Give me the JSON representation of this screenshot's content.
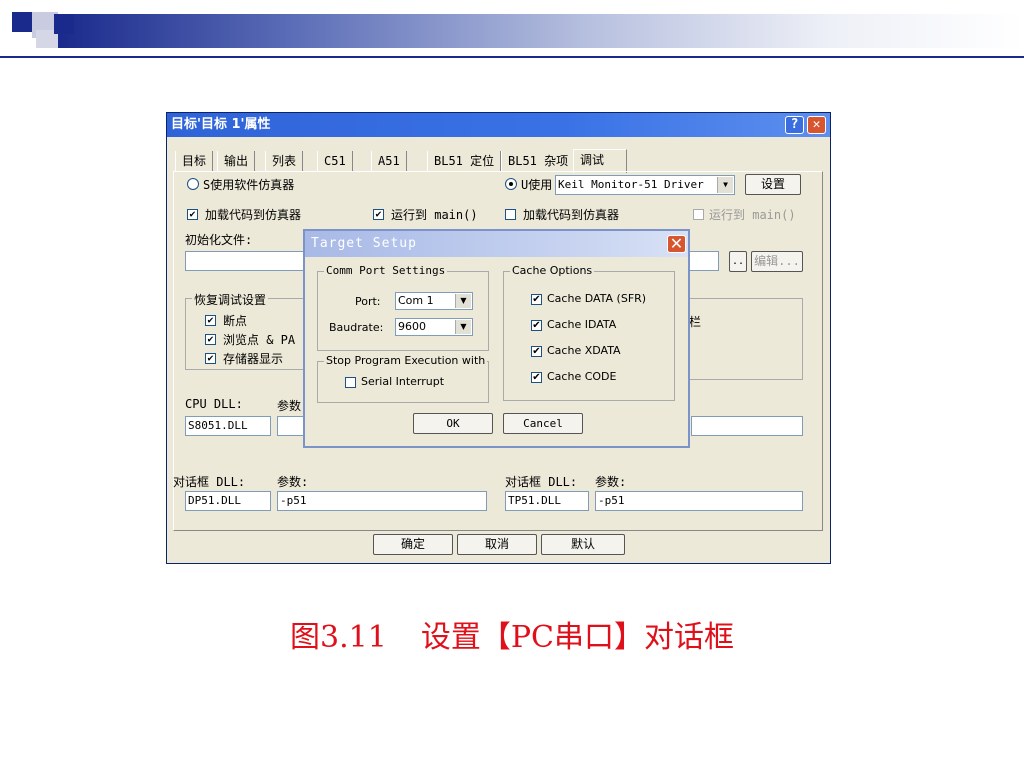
{
  "window": {
    "title": "目标'目标 1'属性",
    "help": "?",
    "close": "✕"
  },
  "tabs": [
    "目标",
    "输出",
    "列表",
    "C51",
    "A51",
    "BL51 定位",
    "BL51 杂项",
    "调试"
  ],
  "left": {
    "sim_radio": "S使用软件仿真器",
    "load_code": "加载代码到仿真器",
    "run_main": "运行到 main()",
    "init_file_label": "初始化文件:",
    "restore_group": "恢复调试设置",
    "breakpoints": "断点",
    "watchpoints": "浏览点 & PA",
    "memory_display": "存储器显示",
    "cpu_dll_label": "CPU DLL:",
    "params_label": "参数",
    "cpu_dll_value": "S8051.DLL",
    "dlg_dll_label": "对话框 DLL:",
    "dlg_params_label": "参数:",
    "dlg_dll_value": "DP51.DLL",
    "dlg_params_value": "-p51"
  },
  "right": {
    "use_radio": "U使用",
    "driver_value": "Keil Monitor-51 Driver",
    "settings_button": "设置",
    "load_code": "加载代码到仿真器",
    "run_main": "运行到 main()",
    "browse_button": "..",
    "edit_button": "编辑...",
    "toolbar_fragment": "栏",
    "dlg_dll_label": "对话框 DLL:",
    "dlg_params_label": "参数:",
    "dlg_dll_value": "TP51.DLL",
    "dlg_params_value": "-p51"
  },
  "bottom": {
    "ok": "确定",
    "cancel": "取消",
    "default": "默认"
  },
  "target_setup": {
    "title": "Target Setup",
    "close": "✕",
    "comm_group": "Comm Port Settings",
    "port_label": "Port:",
    "port_value": "Com 1",
    "baud_label": "Baudrate:",
    "baud_value": "9600",
    "stop_group": "Stop Program Execution with",
    "serial_interrupt": "Serial Interrupt",
    "cache_group": "Cache Options",
    "cache_data": "Cache DATA (SFR)",
    "cache_idata": "Cache IDATA",
    "cache_xdata": "Cache XDATA",
    "cache_code": "Cache CODE",
    "ok": "OK",
    "cancel": "Cancel"
  },
  "caption": {
    "figure": "图3.11",
    "text": "设置【PC串口】对话框"
  },
  "colors": {
    "title_blue": "#2f64d8",
    "caption_red": "#e0101a",
    "dialog_bg": "#ece9d8"
  }
}
